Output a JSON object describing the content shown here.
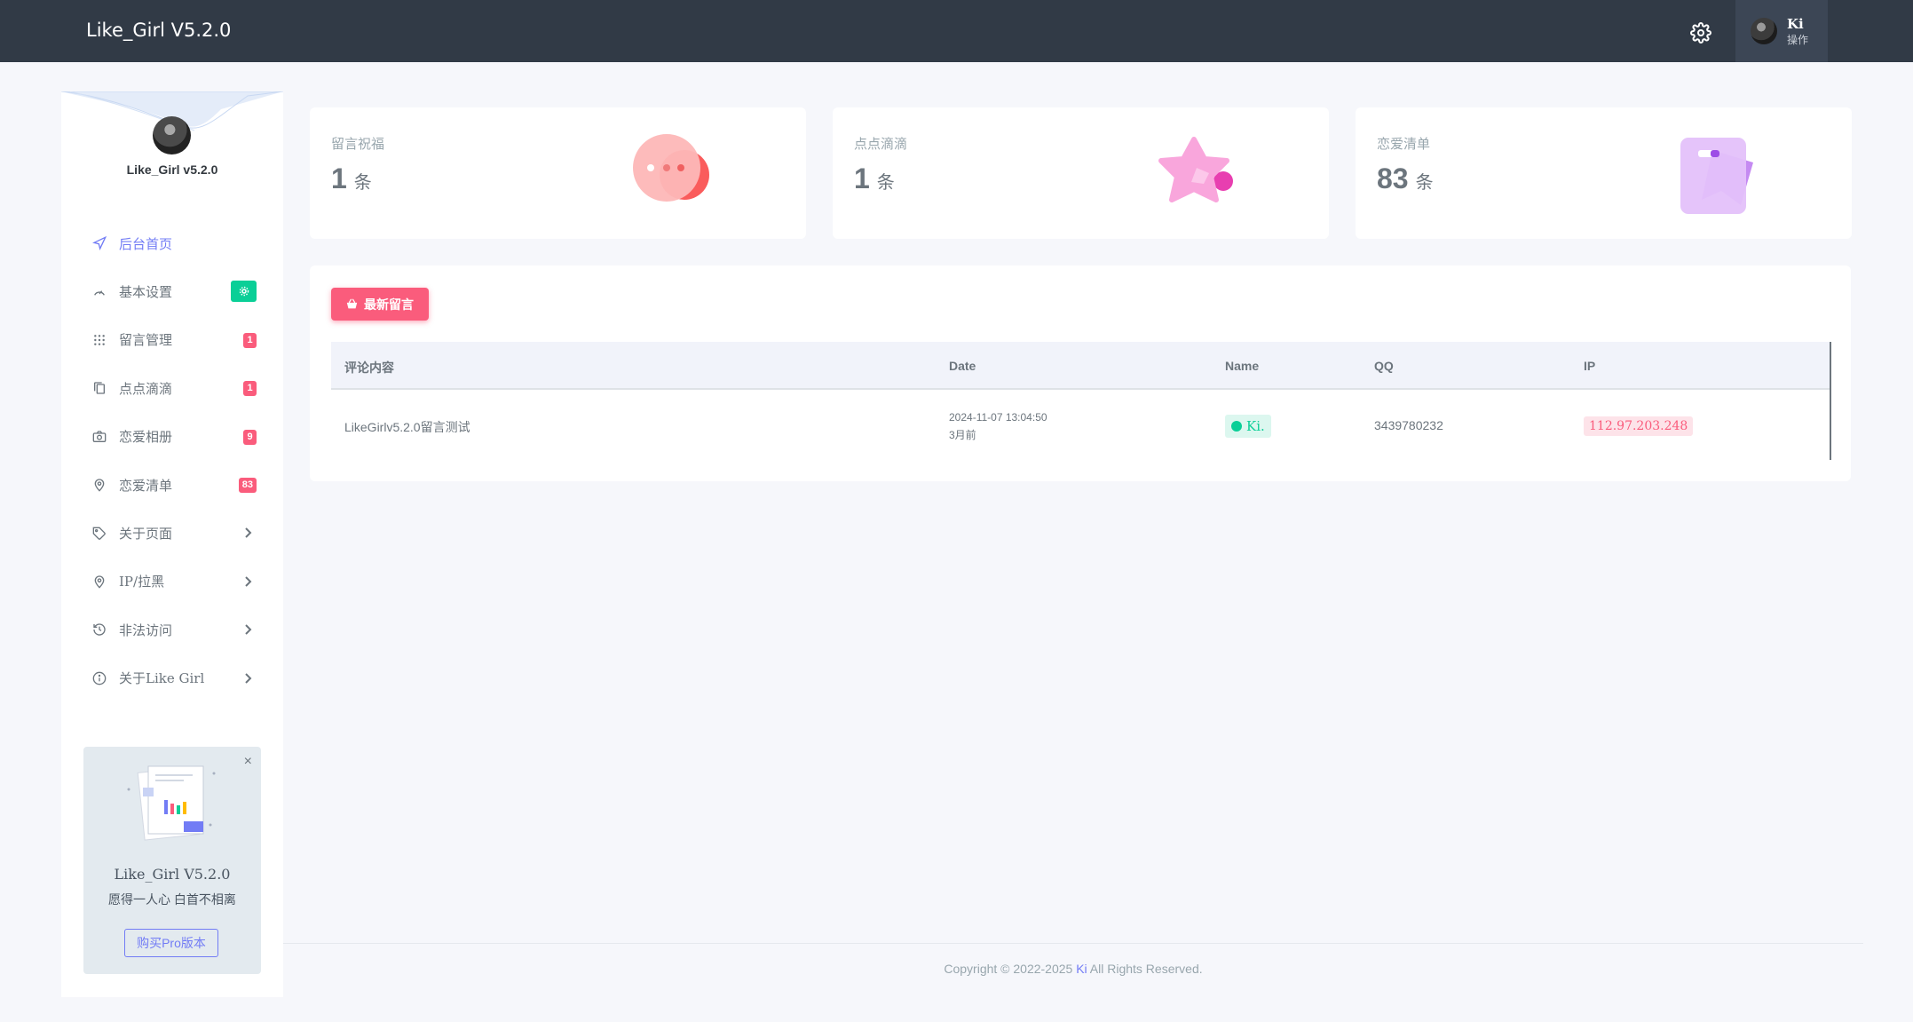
{
  "app": {
    "brand": "Like_Girl V5.2.0"
  },
  "user": {
    "name": "Ki",
    "role": "操作"
  },
  "sidebar": {
    "title": "Like_Girl v5.2.0",
    "items": [
      {
        "label": "后台首页",
        "icon": "navigation-icon",
        "active": true
      },
      {
        "label": "基本设置",
        "icon": "speedometer-icon",
        "badge_icon": "settings-icon"
      },
      {
        "label": "留言管理",
        "icon": "grid-icon",
        "badge": "1"
      },
      {
        "label": "点点滴滴",
        "icon": "copy-icon",
        "badge": "1"
      },
      {
        "label": "恋爱相册",
        "icon": "camera-icon",
        "badge": "9"
      },
      {
        "label": "恋爱清单",
        "icon": "map-pin-icon",
        "badge": "83"
      },
      {
        "label": "关于页面",
        "icon": "tag-icon",
        "chevron": true
      },
      {
        "label": "IP/拉黑",
        "icon": "location-icon",
        "chevron": true
      },
      {
        "label": "非法访问",
        "icon": "history-icon",
        "chevron": true
      },
      {
        "label": "关于Like Girl",
        "icon": "info-icon",
        "chevron": true
      }
    ],
    "promo": {
      "title": "Like_Girl V5.2.0",
      "subtitle": "愿得一人心 白首不相离",
      "button": "购买Pro版本",
      "close": "×"
    }
  },
  "stats": [
    {
      "label": "留言祝福",
      "value": "1",
      "unit": "条",
      "icon": "chat-bubble-icon"
    },
    {
      "label": "点点滴滴",
      "value": "1",
      "unit": "条",
      "icon": "star-icon"
    },
    {
      "label": "恋爱清单",
      "value": "83",
      "unit": "条",
      "icon": "bookmark-icon"
    }
  ],
  "messages": {
    "button": "最新留言",
    "columns": [
      "评论内容",
      "Date",
      "Name",
      "QQ",
      "IP"
    ],
    "rows": [
      {
        "content": "LikeGirlv5.2.0留言测试",
        "date": "2024-11-07 13:04:50",
        "ago": "3月前",
        "name": "Ki.",
        "qq": "3439780232",
        "ip": "112.97.203.248"
      }
    ]
  },
  "footer": {
    "prefix": "Copyright © 2022-2025 ",
    "link": "Ki",
    "suffix": " All Rights Reserved."
  },
  "colors": {
    "topbar": "#313a46",
    "primary": "#727cf5",
    "danger": "#fa5c7c",
    "success": "#0acf97"
  }
}
